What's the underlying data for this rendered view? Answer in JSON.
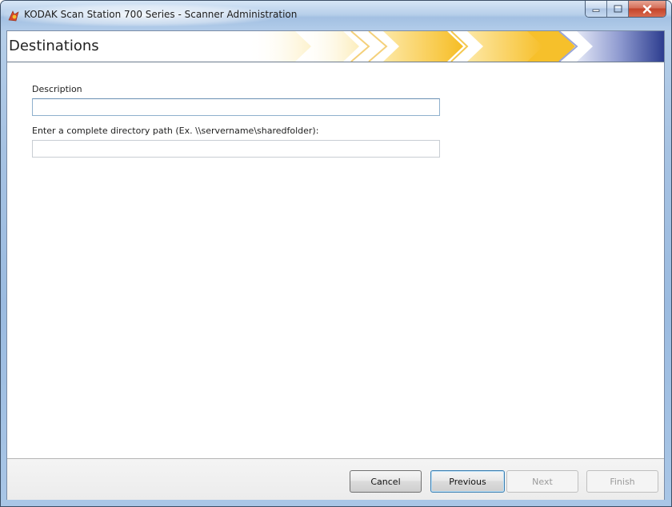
{
  "window": {
    "title": "KODAK Scan Station 700 Series - Scanner Administration",
    "app_icon": "kodak-app-icon",
    "controls": {
      "minimize_icon": "minimize-icon",
      "maximize_icon": "maximize-icon",
      "close_icon": "close-icon"
    }
  },
  "header": {
    "title": "Destinations",
    "decoration": "progress-chevrons"
  },
  "form": {
    "description": {
      "label": "Description",
      "value": ""
    },
    "directory_path": {
      "label": "Enter a complete directory path (Ex. \\\\servername\\sharedfolder):",
      "value": ""
    }
  },
  "footer": {
    "buttons": {
      "cancel": "Cancel",
      "previous": "Previous",
      "next": "Next",
      "finish": "Finish"
    }
  },
  "colors": {
    "title_bar": "#b7cfea",
    "chevron_yellow": "#f7c12a",
    "chevron_blue": "#2d3d8f",
    "close_button": "#c4432a",
    "focused_border": "#8fb0cd"
  }
}
